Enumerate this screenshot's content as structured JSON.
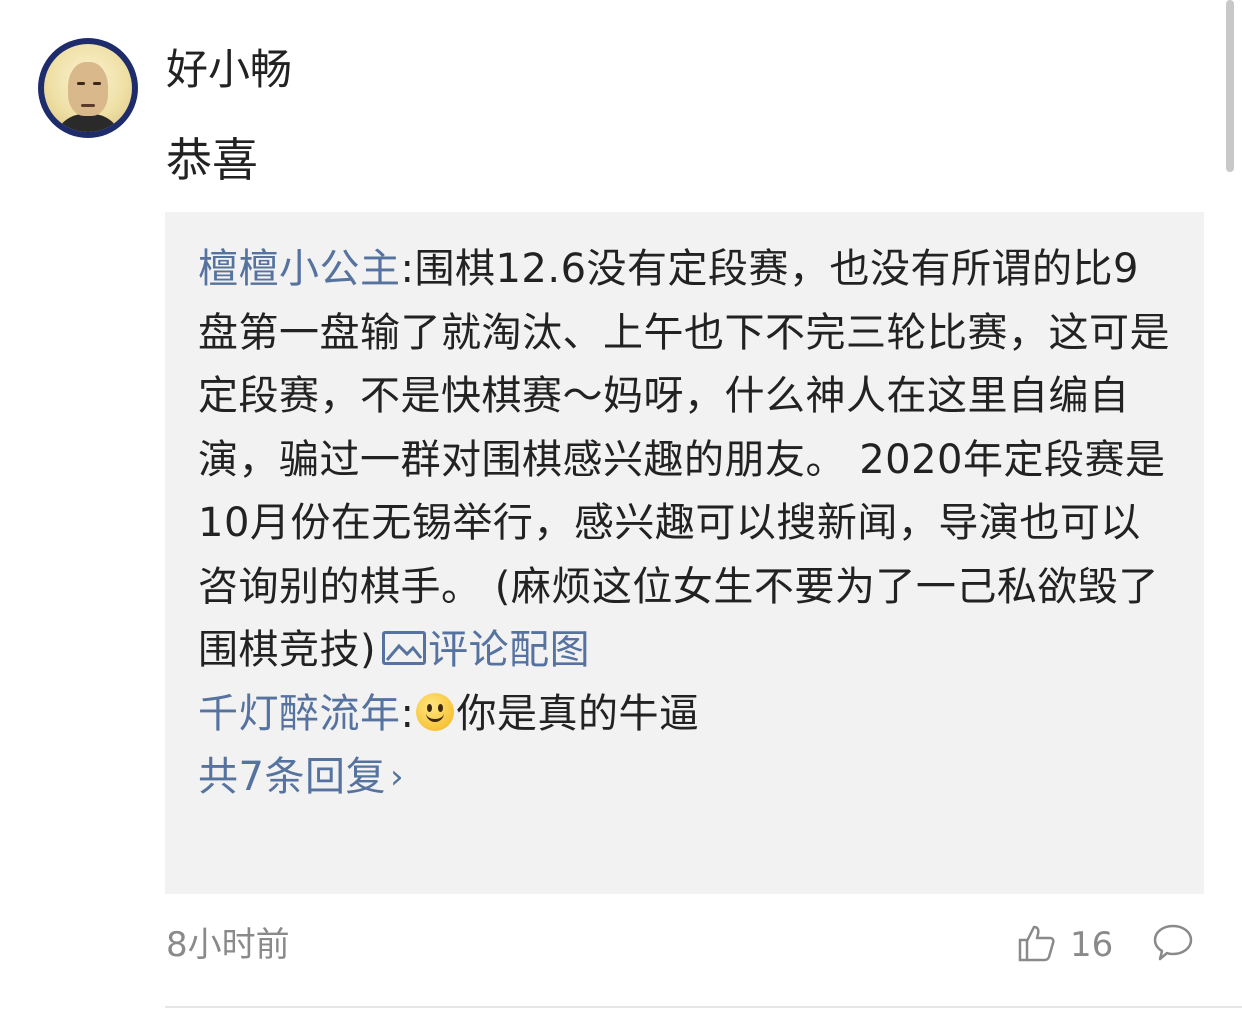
{
  "comment": {
    "username": "好小畅",
    "text": "恭喜",
    "time": "8小时前",
    "like_count": "16"
  },
  "replies": [
    {
      "author": "檀檀小公主",
      "separator": ":",
      "text": "围棋12.6没有定段赛，也没有所谓的比9盘第一盘输了就淘汰、上午也下不完三轮比赛，这可是定段赛，不是快棋赛～妈呀，什么神人在这里自编自演，骗过一群对围棋感兴趣的朋友。 2020年定段赛是10月份在无锡举行，感兴趣可以搜新闻，导演也可以咨询别的棋手。 (麻烦这位女生不要为了一己私欲毁了围棋竞技)",
      "image_link": "评论配图"
    },
    {
      "author": "千灯醉流年",
      "separator": ":",
      "text": "你是真的牛逼"
    }
  ],
  "more_replies": "共7条回复",
  "icons": {
    "avatar": "user-avatar",
    "image": "image-icon",
    "smiley": "smiley-emoji-icon",
    "chevron": "chevron-right-icon",
    "like": "thumbs-up-icon",
    "comment": "comment-bubble-icon"
  },
  "colors": {
    "link": "#56739f",
    "text": "#222222",
    "muted": "#8a8a8a",
    "reply_bg": "#f2f2f2"
  }
}
